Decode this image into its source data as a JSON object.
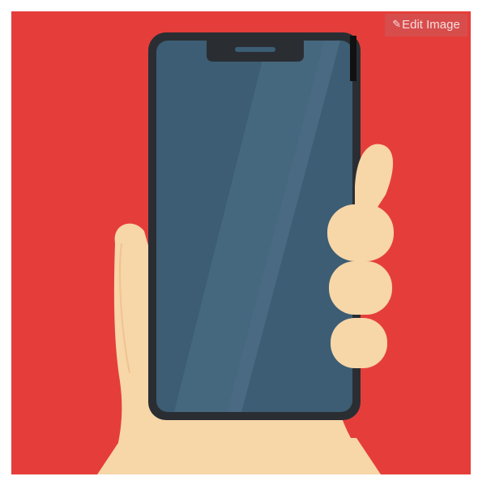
{
  "edit_button": {
    "label": "Edit Image",
    "icon": "pencil-icon"
  },
  "colors": {
    "background": "#e53e3a",
    "skin": "#f7d6a8",
    "phone_screen": "#3c5d73",
    "phone_bezel": "#2a2e33"
  }
}
